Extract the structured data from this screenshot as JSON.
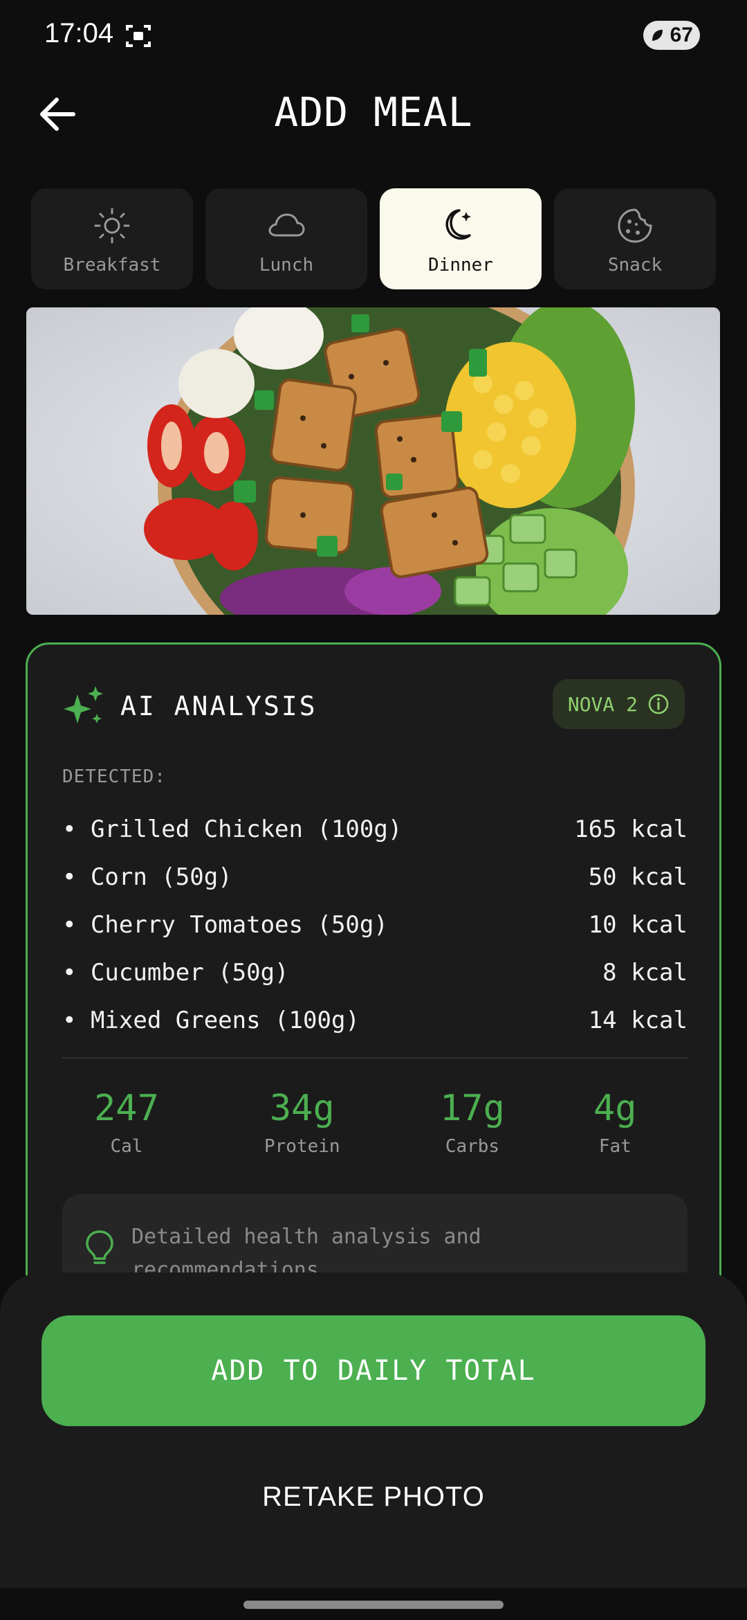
{
  "status_bar": {
    "time": "17:04",
    "battery": "67",
    "icons": [
      "screenshot-icon",
      "leaf-icon"
    ]
  },
  "header": {
    "title": "ADD MEAL",
    "back_icon": "arrow-left-icon"
  },
  "meal_tabs": [
    {
      "label": "Breakfast",
      "icon": "sun-icon",
      "selected": false
    },
    {
      "label": "Lunch",
      "icon": "cloud-icon",
      "selected": false
    },
    {
      "label": "Dinner",
      "icon": "moon-icon",
      "selected": true
    },
    {
      "label": "Snack",
      "icon": "cookie-icon",
      "selected": false
    }
  ],
  "photo": {
    "subject": "salad bowl with grilled chicken, corn, cherry tomatoes, cucumber, greens"
  },
  "analysis": {
    "title": "AI ANALYSIS",
    "badge": "NOVA 2",
    "detected_label": "DETECTED:",
    "items": [
      {
        "name": "Grilled Chicken (100g)",
        "kcal": "165 kcal"
      },
      {
        "name": "Corn (50g)",
        "kcal": "50 kcal"
      },
      {
        "name": "Cherry Tomatoes (50g)",
        "kcal": "10 kcal"
      },
      {
        "name": "Cucumber (50g)",
        "kcal": "8 kcal"
      },
      {
        "name": "Mixed Greens (100g)",
        "kcal": "14 kcal"
      }
    ],
    "macros": [
      {
        "value": "247",
        "label": "Cal"
      },
      {
        "value": "34g",
        "label": "Protein"
      },
      {
        "value": "17g",
        "label": "Carbs"
      },
      {
        "value": "4g",
        "label": "Fat"
      }
    ],
    "tip": "Detailed health analysis and recommendations"
  },
  "actions": {
    "primary": "ADD TO DAILY TOTAL",
    "secondary": "RETAKE PHOTO"
  },
  "colors": {
    "accent": "#4caf50",
    "background": "#0e0e0e",
    "card": "#1b1b1b",
    "selected_tab": "#fbf9ec"
  }
}
